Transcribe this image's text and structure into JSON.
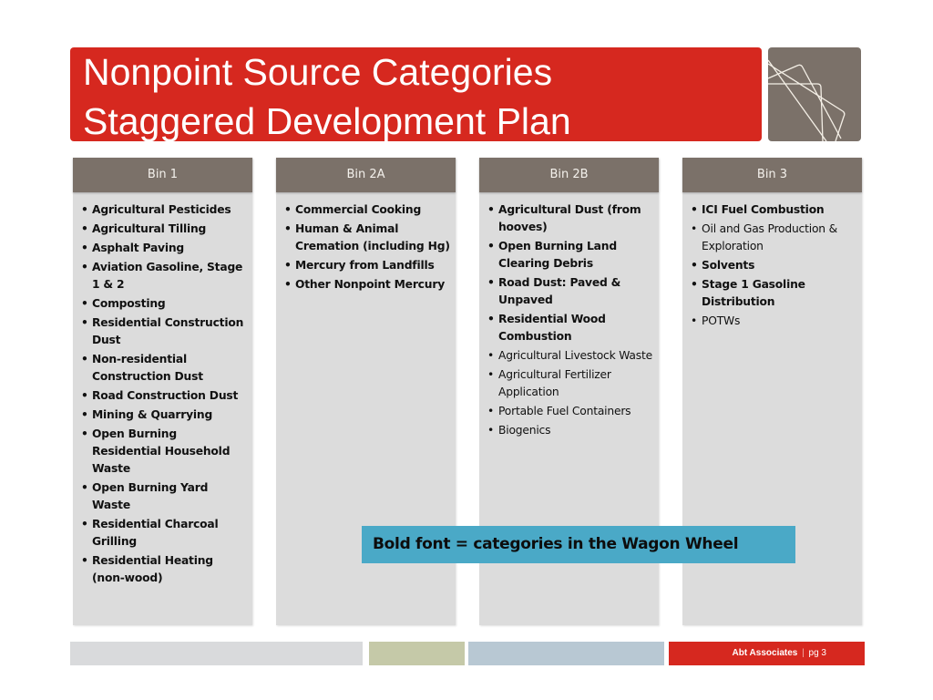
{
  "slide": {
    "title_line1": "Nonpoint Source Categories",
    "title_line2": "Staggered Development Plan",
    "logo_icon": "abstract-lines-logo",
    "colors": {
      "title_bg": "#d6281f",
      "logo_bg": "#7b7169",
      "bin_header_bg": "#7b7169",
      "bin_body_bg": "#dcdcdc",
      "note_bg": "#4aa9c7"
    }
  },
  "bins": [
    {
      "header": "Bin 1",
      "items": [
        {
          "text": "Agricultural Pesticides",
          "bold": true
        },
        {
          "text": "Agricultural Tilling",
          "bold": true
        },
        {
          "text": "Asphalt Paving",
          "bold": true
        },
        {
          "text": "Aviation Gasoline, Stage 1 & 2",
          "bold": true
        },
        {
          "text": "Composting",
          "bold": true
        },
        {
          "text": "Residential Construction Dust",
          "bold": true
        },
        {
          "text": "Non-residential Construction Dust",
          "bold": true
        },
        {
          "text": "Road Construction Dust",
          "bold": true
        },
        {
          "text": "Mining & Quarrying",
          "bold": true
        },
        {
          "text": "Open Burning Residential Household Waste",
          "bold": true
        },
        {
          "text": "Open Burning Yard Waste",
          "bold": true
        },
        {
          "text": "Residential Charcoal Grilling",
          "bold": true
        },
        {
          "text": "Residential Heating (non-wood)",
          "bold": true
        }
      ]
    },
    {
      "header": "Bin 2A",
      "items": [
        {
          "text": "Commercial Cooking",
          "bold": true
        },
        {
          "text": "Human & Animal Cremation (including Hg)",
          "bold": true
        },
        {
          "text": "Mercury from Landfills",
          "bold": true
        },
        {
          "text": "Other Nonpoint Mercury",
          "bold": true
        }
      ]
    },
    {
      "header": "Bin 2B",
      "items": [
        {
          "text": "Agricultural Dust (from hooves)",
          "bold": true
        },
        {
          "text": "Open Burning Land Clearing Debris",
          "bold": true
        },
        {
          "text": "Road Dust: Paved & Unpaved",
          "bold": true
        },
        {
          "text": "Residential Wood Combustion",
          "bold": true
        },
        {
          "text": "Agricultural Livestock Waste",
          "bold": false
        },
        {
          "text": "Agricultural Fertilizer Application",
          "bold": false
        },
        {
          "text": "Portable Fuel Containers",
          "bold": false
        },
        {
          "text": "Biogenics",
          "bold": false
        }
      ]
    },
    {
      "header": "Bin 3",
      "items": [
        {
          "text": "ICI Fuel Combustion",
          "bold": true
        },
        {
          "text": "Oil and Gas Production & Exploration",
          "bold": false
        },
        {
          "text": "Solvents",
          "bold": true
        },
        {
          "text": "Stage 1 Gasoline Distribution",
          "bold": true
        },
        {
          "text": "POTWs",
          "bold": false
        }
      ]
    }
  ],
  "note": "Bold font = categories in the Wagon Wheel",
  "footer": {
    "company": "Abt Associates",
    "separator": "|",
    "page": "pg 3",
    "bar_colors": [
      "#d9dadc",
      "#c5c9a8",
      "#b8c8d3",
      "#d6281f"
    ]
  }
}
